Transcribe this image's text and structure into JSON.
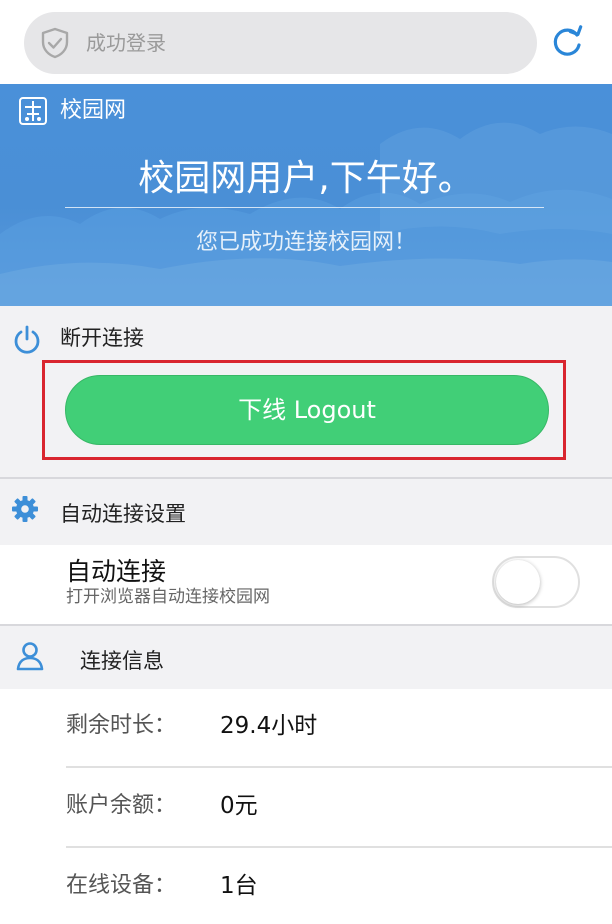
{
  "addressbar": {
    "url_text": "成功登录",
    "shield_icon": "shield-icon",
    "refresh_icon": "refresh-icon"
  },
  "banner": {
    "brand": "校园网",
    "greeting": "校园网用户,下午好。",
    "subtitle": "您已成功连接校园网！",
    "color": "#4a90d9"
  },
  "disconnect": {
    "title": "断开连接",
    "icon": "power-icon",
    "logout_label": "下线 Logout",
    "button_color": "#41cf77",
    "highlight_color": "#d9262f"
  },
  "auto_connect": {
    "section_title": "自动连接设置",
    "icon": "gear-icon",
    "label": "自动连接",
    "description": "打开浏览器自动连接校园网",
    "enabled": false
  },
  "connection_info": {
    "section_title": "连接信息",
    "icon": "user-icon",
    "rows": [
      {
        "label": "剩余时长：",
        "value": "29.4小时"
      },
      {
        "label": "账户余额：",
        "value": "0元"
      },
      {
        "label": "在线设备：",
        "value": "1台"
      }
    ]
  },
  "accent_color": "#3d8fd8"
}
